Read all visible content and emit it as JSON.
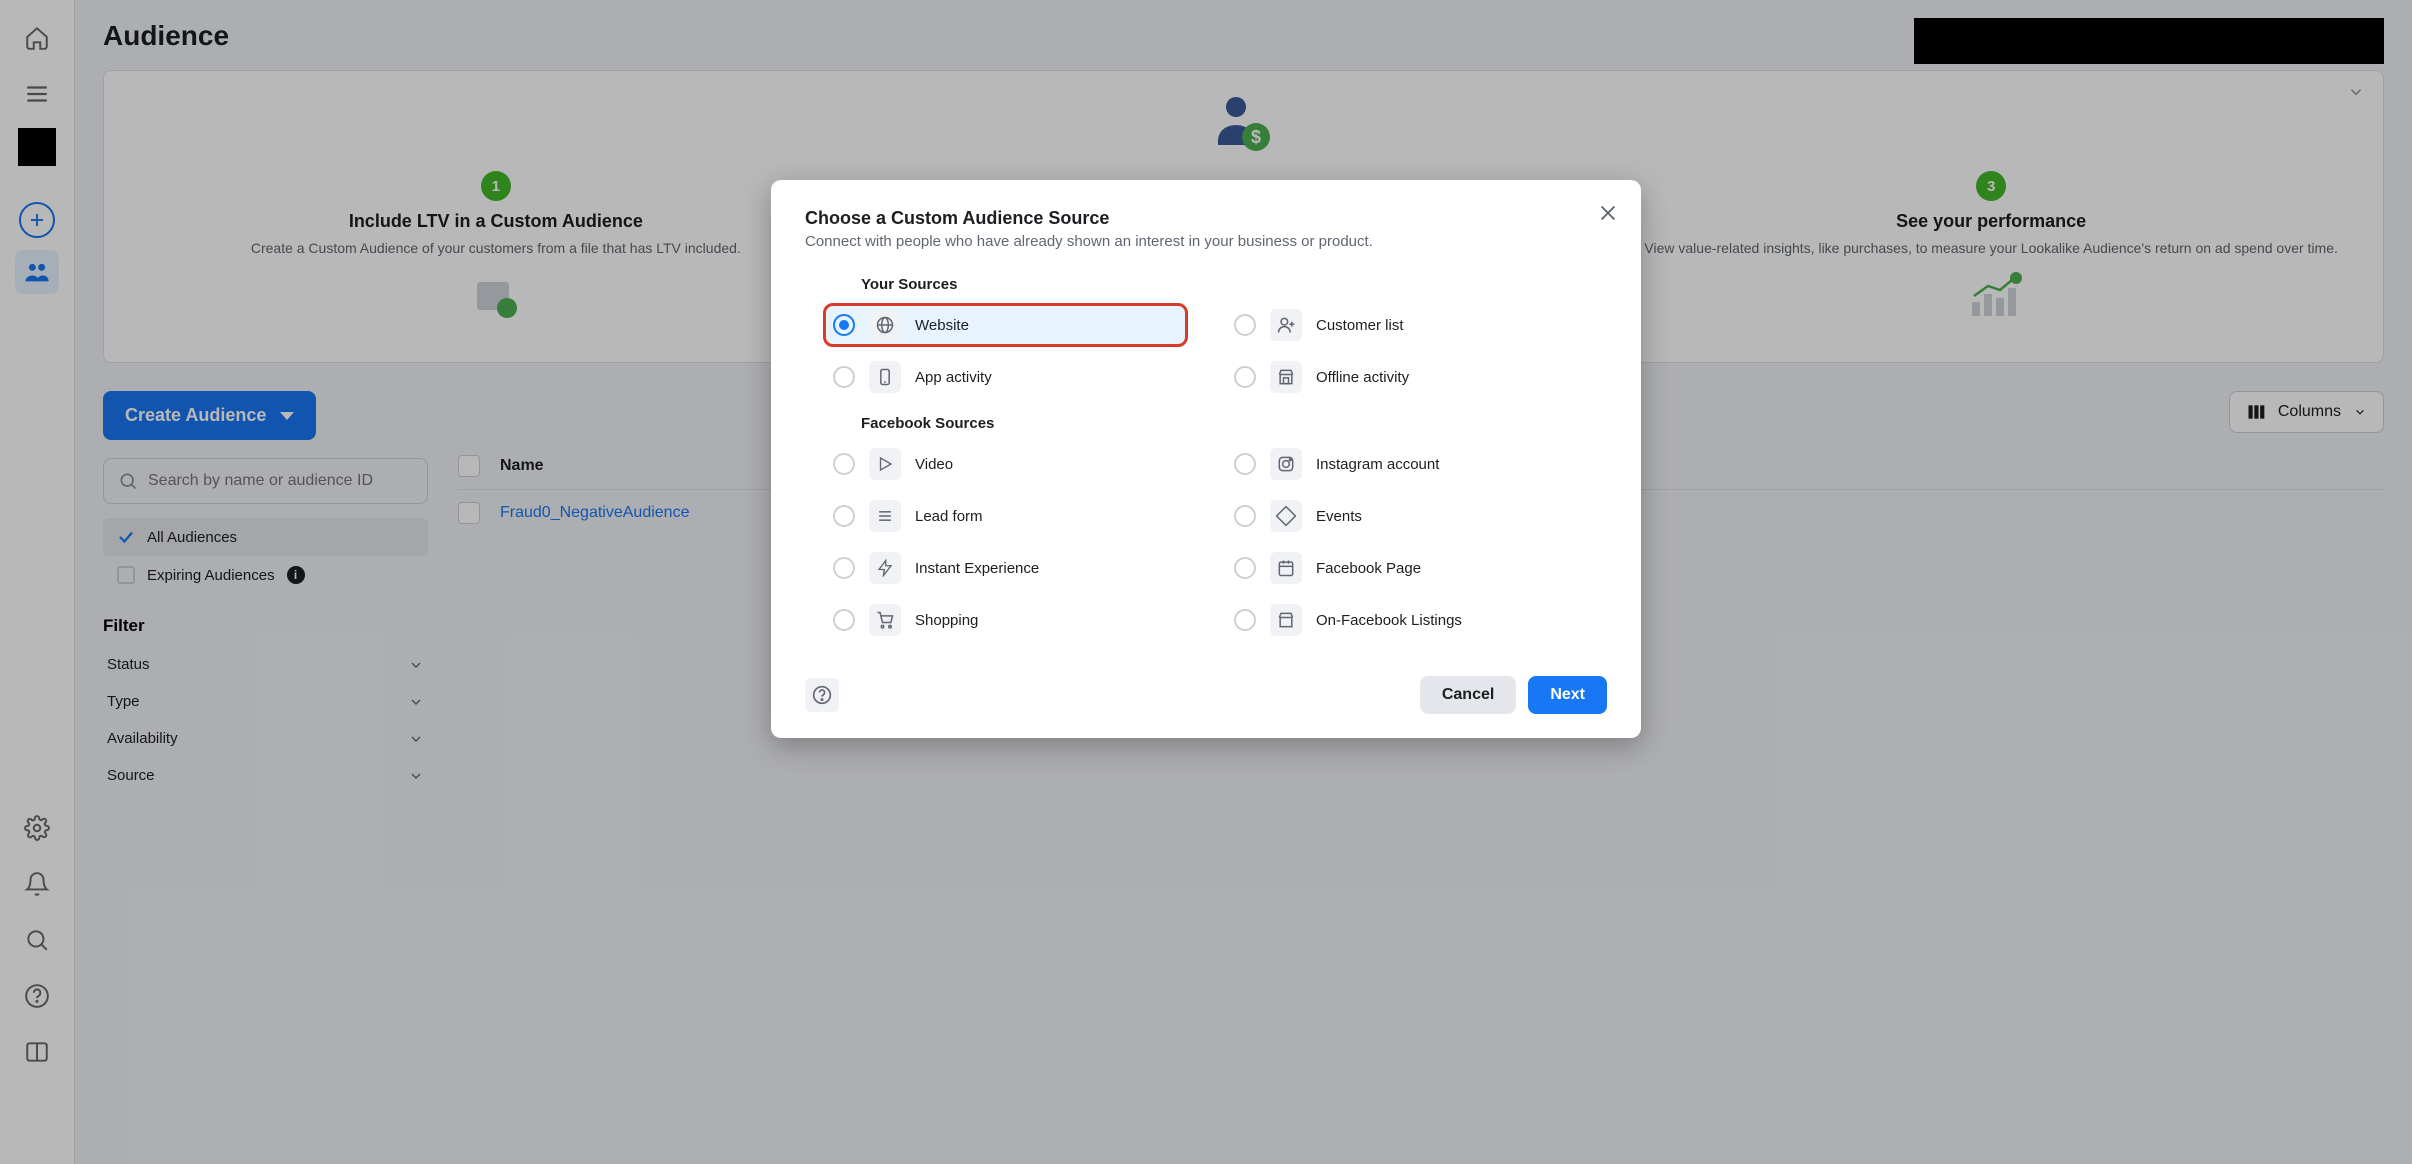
{
  "page": {
    "title": "Audience"
  },
  "hero": {
    "step1": {
      "num": "1",
      "title": "Include LTV in a Custom Audience",
      "desc": "Create a Custom Audience of your customers from a file that has LTV included."
    },
    "step3": {
      "num": "3",
      "title": "See your performance",
      "desc": "View value-related insights, like purchases, to measure your Lookalike Audience's return on ad spend over time."
    }
  },
  "create_btn": "Create Audience",
  "search": {
    "placeholder": "Search by name or audience ID"
  },
  "aud": {
    "all": "All Audiences",
    "exp": "Expiring Audiences"
  },
  "filter": {
    "head": "Filter",
    "status": "Status",
    "type": "Type",
    "avail": "Availability",
    "source": "Source"
  },
  "table": {
    "col_name": "Name",
    "row1": "Fraud0_NegativeAudience",
    "columns_btn": "Columns"
  },
  "modal": {
    "title": "Choose a Custom Audience Source",
    "desc": "Connect with people who have already shown an interest in your business or product.",
    "your_sources": "Your Sources",
    "fb_sources": "Facebook Sources",
    "website": "Website",
    "customer_list": "Customer list",
    "app_activity": "App activity",
    "offline_activity": "Offline activity",
    "video": "Video",
    "instagram": "Instagram account",
    "lead_form": "Lead form",
    "events": "Events",
    "instant": "Instant Experience",
    "fb_page": "Facebook Page",
    "shopping": "Shopping",
    "listings": "On-Facebook Listings",
    "cancel": "Cancel",
    "next": "Next"
  }
}
